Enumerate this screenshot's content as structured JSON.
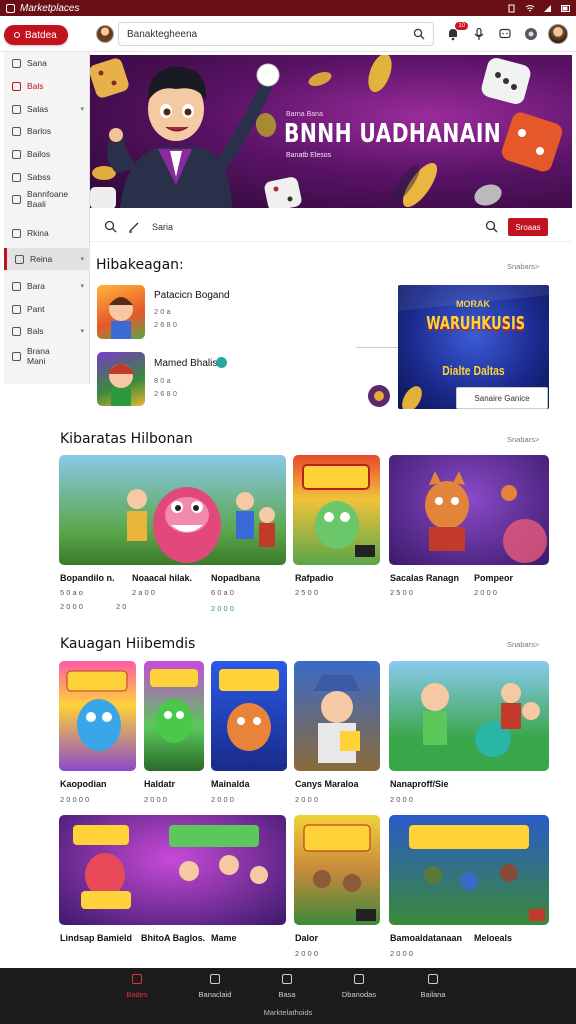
{
  "status_bar": {
    "title": "Marketplaces"
  },
  "header": {
    "brand_label": "Batdea",
    "search_value": "Banaktegheena",
    "notification_count": "10",
    "icons": [
      "bell-icon",
      "mic-icon",
      "chat-icon"
    ]
  },
  "sidebar": {
    "items": [
      {
        "label": "Sana",
        "icon": "doc-icon"
      },
      {
        "label": "Bals",
        "icon": "grid-icon",
        "active": true
      },
      {
        "label": "Salas",
        "icon": "list-icon",
        "chevron": true
      },
      {
        "label": "Barlos",
        "icon": "box-icon"
      },
      {
        "label": "Bailos",
        "icon": "chat-icon"
      },
      {
        "label": "Sabss",
        "icon": "people-icon"
      },
      {
        "label": "Bannfoane",
        "label2": "Baali",
        "icon": "flower-icon"
      },
      {
        "label": "Rkina",
        "icon": "calendar-icon"
      },
      {
        "label": "Reina",
        "icon": "card-icon",
        "selected": true,
        "chevron": true
      },
      {
        "label": "Bara",
        "icon": "tag-icon",
        "chevron": true
      },
      {
        "label": "Pant",
        "icon": "pin-icon"
      },
      {
        "label": "Bals",
        "icon": "store-icon",
        "chevron": true
      },
      {
        "label": "Brana",
        "label2": "Mani",
        "icon": "person-icon"
      }
    ]
  },
  "hero": {
    "tag": "Barna Bana",
    "title": "BNNH UADHANAIN",
    "subtitle": "Banatb Elesos"
  },
  "filter_bar": {
    "text": "Saria",
    "sort_label": "Sroaas"
  },
  "section1": {
    "title": "Hibakeagan:",
    "see_all": "Snabars>",
    "items": [
      {
        "name": "Patacicn Bogand",
        "meta1": "2 0 a",
        "meta2": "2 6 8 0"
      },
      {
        "name": "Mamed Bhalis",
        "meta1": "8 0 a",
        "meta2": "2 6 8 0"
      }
    ],
    "promo": {
      "top": "MORAK",
      "main": "WARUHKUSIS",
      "lower": "Dialte Daltas",
      "button": "Sanaire Ganice"
    }
  },
  "section2": {
    "title": "Kibaratas Hilbonan",
    "see_all": "Snabars>",
    "cards": [
      {
        "title": "Bopandilo n.",
        "meta": "5 0 a o",
        "meta2": "2 0 0 0"
      },
      {
        "title": "Noaacal hilak.",
        "meta": "2 a 0 0",
        "meta2": "2 0"
      },
      {
        "title": "Nopadbana",
        "meta": "6 0 a 0",
        "meta2": ""
      },
      {
        "title": "Rafpadio",
        "meta": "2 5 0 0",
        "meta2": ""
      },
      {
        "title": "Sacalas Ranagn",
        "meta": "2 5 0 0",
        "meta2": ""
      },
      {
        "title": "Pompeor",
        "meta": "2 0 0 0",
        "meta2": ""
      }
    ]
  },
  "section3": {
    "title": "Kauagan Hiibemdis",
    "see_all": "Snabars>",
    "cards_row1": [
      {
        "title": "Kaopodian",
        "meta": "2 0 0 0 0"
      },
      {
        "title": "Haldatr",
        "meta": "2 0 0 0"
      },
      {
        "title": "Mainalda",
        "meta": "2 0 0 0"
      },
      {
        "title": "Canys Maraloa",
        "meta": "2 0 0 0"
      },
      {
        "title": "Nanaproff/Sie",
        "meta": "2 0 0 0"
      }
    ],
    "cards_row2": [
      {
        "title": "Lindsap Bamield",
        "meta": ""
      },
      {
        "title": "BhitoA Baglos.",
        "meta": ""
      },
      {
        "title": "Mame",
        "meta": ""
      },
      {
        "title": "Dalor",
        "meta": "2 0 0 0"
      },
      {
        "title": "Bamoaldatanaan",
        "meta": "2 0 0 0"
      },
      {
        "title": "Meloeals",
        "meta": ""
      }
    ]
  },
  "bottom_nav": {
    "items": [
      {
        "label": "Bades",
        "active": true
      },
      {
        "label": "Banaclaid"
      },
      {
        "label": "Basa"
      },
      {
        "label": "Dbanodas"
      },
      {
        "label": "Bailana"
      }
    ],
    "footer": "Marktelathoids"
  },
  "colors": {
    "accent": "#c1121f",
    "status_bar": "#6b0f17",
    "nav": "#1c1c1c"
  }
}
